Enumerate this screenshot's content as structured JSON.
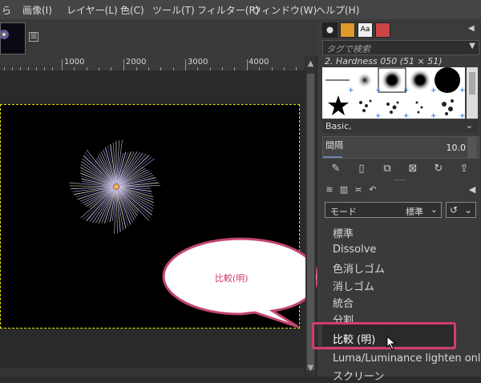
{
  "menubar": {
    "items": [
      "ら",
      "画像(I)",
      "レイヤー(L)",
      "色(C)",
      "ツール(T)",
      "フィルター(R)",
      "ウィンドウ(W)",
      "ヘルプ(H)"
    ]
  },
  "image_tab": {
    "close_glyph": "⊠"
  },
  "ruler": {
    "labels": [
      "1000",
      "2000",
      "3000",
      "4000"
    ]
  },
  "brushes": {
    "tag_placeholder": "タグで検索",
    "selected_brush": "2. Hardness 050 (51 × 51)",
    "preset": "Basic,",
    "spacing_label": "間隔",
    "spacing_value": "10.0"
  },
  "layers": {
    "mode_label": "モード",
    "mode_value": "標準"
  },
  "mode_options": [
    "標準",
    "Dissolve",
    "色消しゴム",
    "消しゴム",
    "統合",
    "分割",
    "比較 (明)",
    "Luma/Luminance lighten only",
    "スクリーン"
  ],
  "callout": {
    "text": "比較(明)"
  },
  "colors": {
    "highlight": "#d33c74",
    "selection_outline": "#e6e600",
    "callout_border": "#c2456f"
  },
  "icons": [
    "close-icon",
    "configure-icon",
    "dropdown-icon",
    "reset-icon",
    "cursor-icon"
  ]
}
